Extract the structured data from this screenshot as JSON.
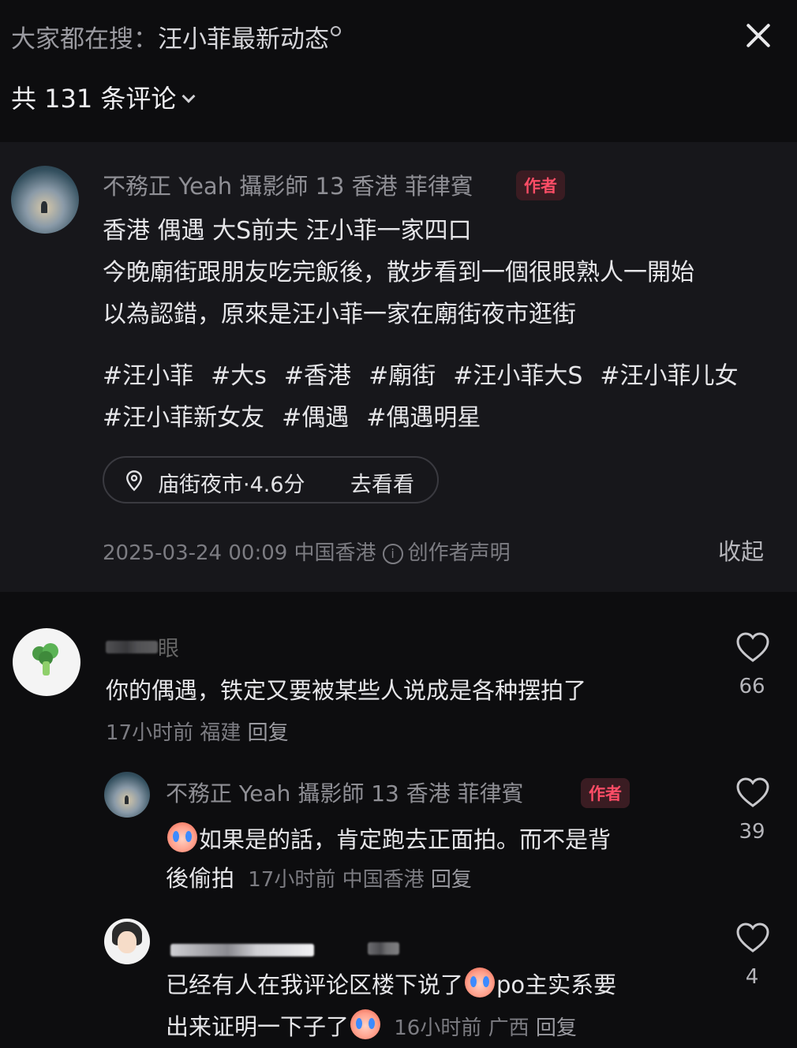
{
  "header": {
    "search_prefix": "大家都在搜：",
    "search_keyword": "汪小菲最新动态",
    "comment_count": "共 131 条评论"
  },
  "post": {
    "username": "不務正 Yeah 攝影師 13 香港 菲律賓",
    "badge": "作者",
    "lines": [
      "香港 偶遇 大S前夫 汪小菲一家四口",
      "今晚廟街跟朋友吃完飯後，散步看到一個很眼熟人一開始",
      "以為認錯，原來是汪小菲一家在廟街夜市逛街"
    ],
    "tags_line1": [
      "#汪小菲",
      "#大s",
      "#香港",
      "#廟街",
      "#汪小菲大S",
      "#汪小菲儿女"
    ],
    "tags_line2": [
      "#汪小菲新女友",
      "#偶遇",
      "#偶遇明星"
    ],
    "location": "庙街夜市·4.6分",
    "location_action": "去看看",
    "meta_time": "2025-03-24 00:09 中国香港",
    "meta_declaration": "创作者声明",
    "collapse": "收起"
  },
  "comments": [
    {
      "username_masked": "眼",
      "text": "你的偶遇，铁定又要被某些人说成是各种摆拍了",
      "meta_time": "17小时前 福建",
      "reply": "回复",
      "likes": "66",
      "avatar_icon": "broccoli-icon"
    },
    {
      "username": "不務正 Yeah 攝影師 13 香港 菲律賓",
      "badge": "作者",
      "text_line1": "如果是的話，肯定跑去正面拍。而不是背",
      "text_line2": "後偷拍",
      "meta_time": "17小时前 中国香港",
      "reply": "回复",
      "likes": "39"
    },
    {
      "text_line1_a": "已经有人在我评论区楼下说了",
      "text_line1_b": "po主实系要",
      "text_line2": "出来证明一下子了",
      "meta_time": "16小时前 广西",
      "reply": "回复",
      "likes": "4"
    }
  ],
  "colors": {
    "background": "#0d0d0f",
    "post_background": "#17171b",
    "author_badge": "#ff4d66",
    "secondary_text": "#7c7c82"
  }
}
